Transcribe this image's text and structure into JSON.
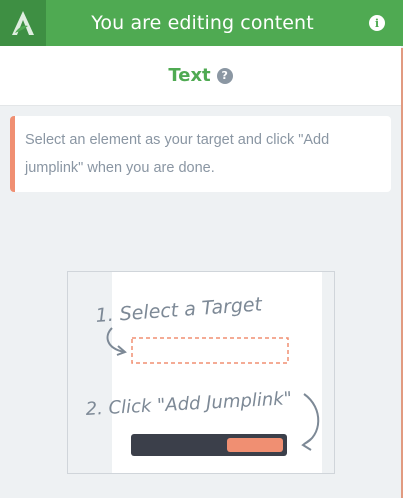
{
  "header": {
    "logo_icon": "leaf-a-logo-icon",
    "title": "You are editing content",
    "info_icon": "info-icon"
  },
  "subheader": {
    "title": "Text",
    "help_icon": "question-icon"
  },
  "notice": {
    "text": "Select an element as your target and click \"Add jumplink\" when you are done."
  },
  "illustration": {
    "step1": "1. Select a Target",
    "step2": "2. Click \"Add Jumplink\""
  },
  "colors": {
    "header_green": "#4faa52",
    "logo_green": "#3e8f43",
    "accent_orange": "#f08f72",
    "muted_text": "#8a96a3",
    "dark_bar": "#3b3f4a"
  }
}
